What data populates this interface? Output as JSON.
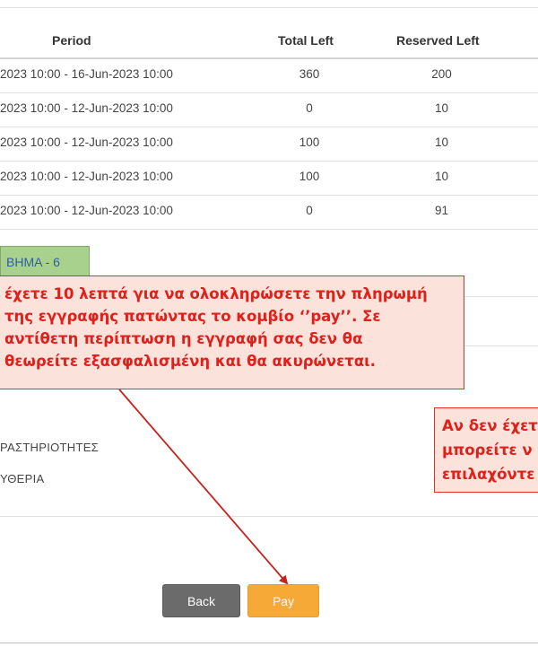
{
  "table": {
    "headers": {
      "period": "Period",
      "total_left": "Total Left",
      "reserved_left": "Reserved Left"
    },
    "rows": [
      {
        "period": "2023 10:00 - 16-Jun-2023 10:00",
        "total_left": "360",
        "reserved_left": "200"
      },
      {
        "period": "2023 10:00 - 12-Jun-2023 10:00",
        "total_left": "0",
        "reserved_left": "10"
      },
      {
        "period": "2023 10:00 - 12-Jun-2023 10:00",
        "total_left": "100",
        "reserved_left": "10"
      },
      {
        "period": "2023 10:00 - 12-Jun-2023 10:00",
        "total_left": "100",
        "reserved_left": "10"
      },
      {
        "period": "2023 10:00 - 12-Jun-2023 10:00",
        "total_left": "0",
        "reserved_left": "91"
      }
    ]
  },
  "step_tag": "ΒΗΜΑ - 6",
  "note_main": {
    "line1": "έχετε 10 λεπτά για να ολοκληρώσετε την πληρωμή",
    "line2": "της εγγραφής πατώντας το κομβίο ‘’pay’’.  Σε",
    "line3": "αντίθετη περίπτωση η εγγραφή σας δεν θα",
    "line4": "θεωρείτε εξασφαλισμένη και θα ακυρώνεται."
  },
  "note_side": {
    "line1": "Αν δεν έχετ",
    "line2": "μπορείτε ν",
    "line3": "επιλαχόντε"
  },
  "labels": {
    "activities": "ΡΑΣΤΗΡΙΟΤΗΤΕΣ",
    "freedom": "ΥΘΕΡΙΑ"
  },
  "buttons": {
    "back": "Back",
    "pay": "Pay"
  },
  "colors": {
    "pay": "#f7a938",
    "back": "#6b6b6b",
    "step_tag": "#a9d18e",
    "note_border": "#d9342b",
    "note_text": "#e0201a"
  }
}
